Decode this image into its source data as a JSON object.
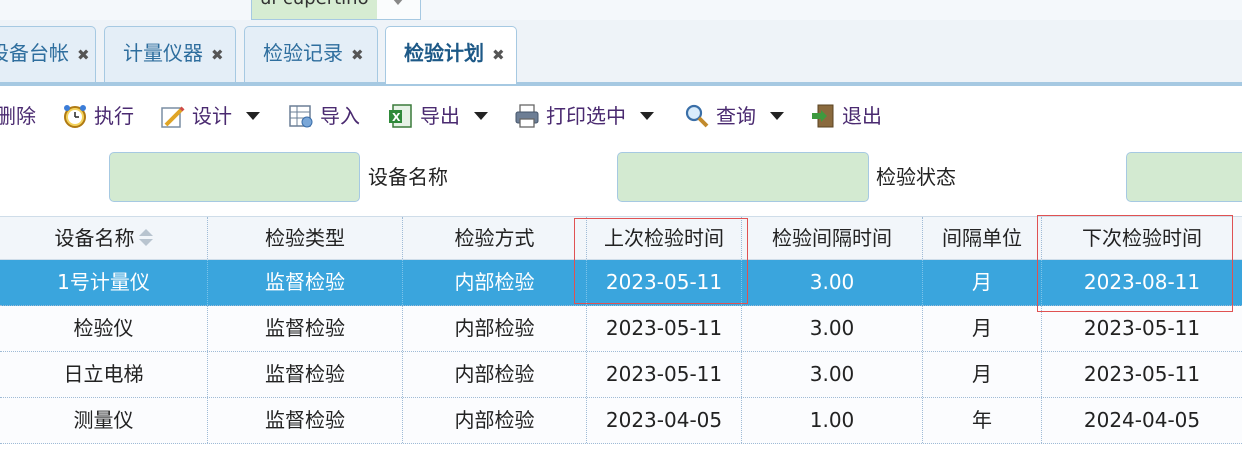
{
  "theme": {
    "selected": "ui-cupertino"
  },
  "tabs": [
    {
      "label": "设备台帐",
      "active": false
    },
    {
      "label": "计量仪器",
      "active": false
    },
    {
      "label": "检验记录",
      "active": false
    },
    {
      "label": "检验计划",
      "active": true
    }
  ],
  "tab_close": "✖",
  "toolbar": {
    "delete": "删除",
    "execute": "执行",
    "design": "设计",
    "import": "导入",
    "export": "导出",
    "print_selected": "打印选中",
    "query": "查询",
    "exit": "退出"
  },
  "filters": {
    "device_name_label": "设备名称",
    "device_name_value": "",
    "status_label": "检验状态",
    "status_value": "",
    "third_value": ""
  },
  "grid": {
    "columns": [
      "设备名称",
      "检验类型",
      "检验方式",
      "上次检验时间",
      "检验间隔时间",
      "间隔单位",
      "下次检验时间"
    ],
    "rows": [
      [
        "1号计量仪",
        "监督检验",
        "内部检验",
        "2023-05-11",
        "3.00",
        "月",
        "2023-08-11"
      ],
      [
        "检验仪",
        "监督检验",
        "内部检验",
        "2023-05-11",
        "3.00",
        "月",
        "2023-05-11"
      ],
      [
        "日立电梯",
        "监督检验",
        "内部检验",
        "2023-05-11",
        "3.00",
        "月",
        "2023-05-11"
      ],
      [
        "测量仪",
        "监督检验",
        "内部检验",
        "2023-04-05",
        "1.00",
        "年",
        "2024-04-05"
      ]
    ],
    "selected_row": 0
  },
  "colors": {
    "selected_row": "#3aa5dd",
    "tab_text": "#2e6e9e",
    "input_bg": "#d3ead1",
    "highlight_box": "#e05252"
  }
}
